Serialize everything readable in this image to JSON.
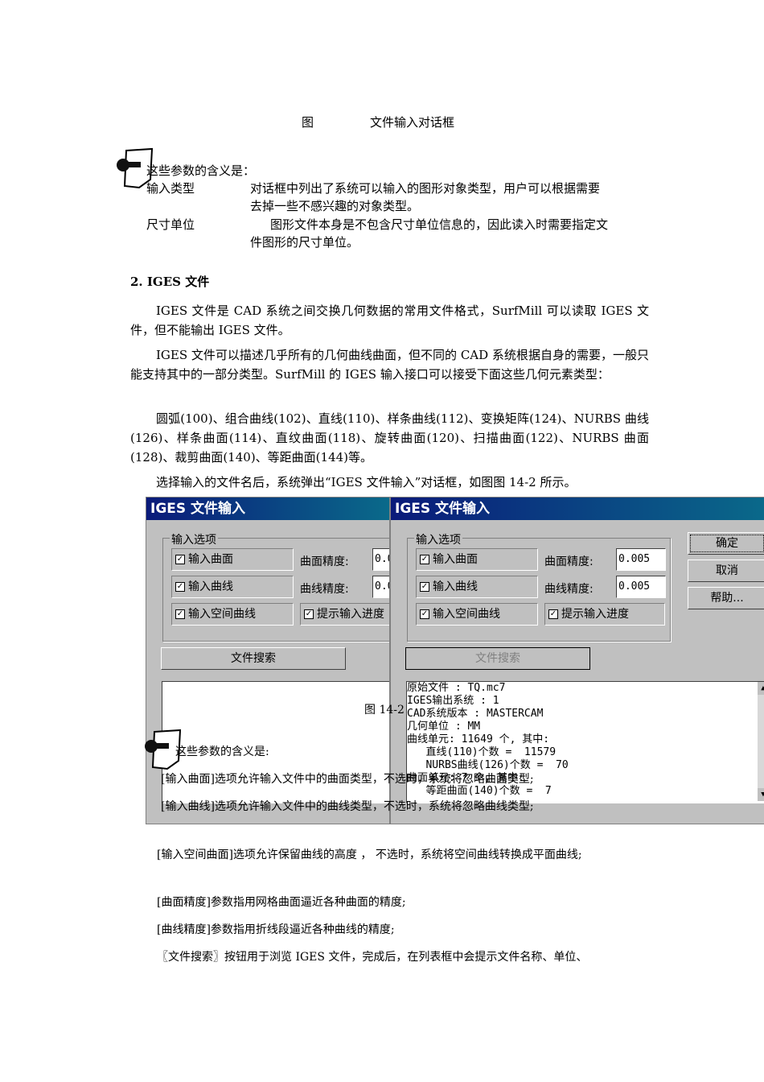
{
  "caption_top": {
    "fig": "图",
    "title": "文件输入对话框"
  },
  "note1": {
    "intro": "这些参数的含义是：",
    "rows": [
      {
        "term": "输入类型",
        "desc1": "对话框中列出了系统可以输入的图形对象类型，用户可以根据需要",
        "desc2": "去掉一些不感兴趣的对象类型。"
      },
      {
        "term": "尺寸单位",
        "desc1": "图形文件本身是不包含尺寸单位信息的，因此读入时需要指定文",
        "desc2": "件图形的尺寸单位。"
      }
    ]
  },
  "section": "2.  IGES 文件",
  "paragraphs": [
    "IGES 文件是 CAD 系统之间交换几何数据的常用文件格式，SurfMill 可以读取 IGES 文件，但不能输出 IGES 文件。",
    "IGES 文件可以描述几乎所有的几何曲线曲面，但不同的 CAD 系统根据自身的需要，一般只能支持其中的一部分类型。SurfMill 的 IGES 输入接口可以接受下面这些几何元素类型：",
    "圆弧(100)、组合曲线(102)、直线(110)、样条曲线(112)、变换矩阵(124)、NURBS 曲线(126)、样条曲面(114)、直纹曲面(118)、旋转曲面(120)、扫描曲面(122)、NURBS 曲面(128)、裁剪曲面(140)、等距曲面(144)等。",
    "选择输入的文件名后，系统弹出“IGES 文件输入”对话框，如图图 14-2 所示。"
  ],
  "dialog": {
    "title": "IGES 文件输入",
    "group": "输入选项",
    "surface": "输入曲面",
    "curve": "输入曲线",
    "space_curve": "输入空间曲线",
    "progress": "提示输入进度",
    "surf_tol_label": "曲面精度:",
    "curve_tol_label": "曲线精度:",
    "surf_tol": "0.005",
    "curve_tol": "0.005",
    "left_tol_cut": "0.0",
    "search": "文件搜索",
    "ok": "确定",
    "cancel": "取消",
    "help": "帮助...",
    "list": [
      "原始文件 :  TQ.mc7",
      "IGES输出系统 :  1",
      "CAD系统版本 :  MASTERCAM",
      "几何单位 :  MM",
      "曲线单元: 11649 个, 其中:",
      "   直线(110)个数 =  11579",
      "   NURBS曲线(126)个数 =  70",
      "曲面单元: 7 个, 其中:",
      "   等距曲面(140)个数 =  7"
    ]
  },
  "fig_label": "图 14-2",
  "note2": {
    "intro": "这些参数的含义是:",
    "items": [
      "[输入曲面]选项允许输入文件中的曲面类型，不选时，系统将忽略曲面类型;",
      "[输入曲线]选项允许输入文件中的曲线类型，不选时，系统将忽略曲线类型;"
    ]
  },
  "after": [
    "[输入空间曲面]选项允许保留曲线的高度 ， 不选时，系统将空间曲线转换成平面曲线;",
    "[曲面精度]参数指用网格曲面逼近各种曲面的精度;",
    "[曲线精度]参数指用折线段逼近各种曲线的精度;",
    "〖文件搜索〗按钮用于浏览 IGES 文件，完成后，在列表框中会提示文件名称、单位、"
  ]
}
